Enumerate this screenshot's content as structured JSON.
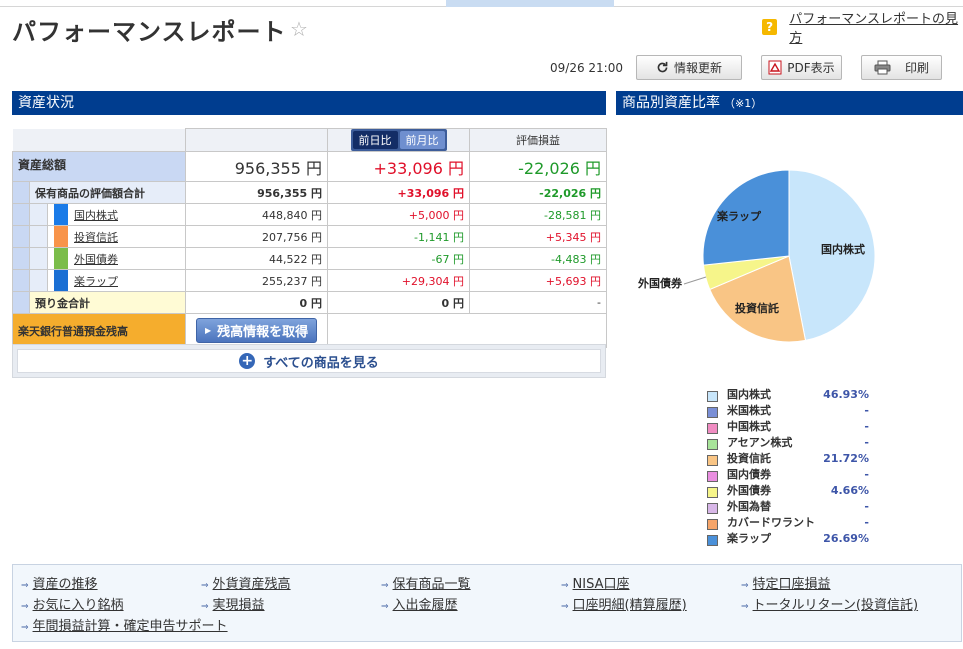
{
  "page": {
    "title": "パフォーマンスレポート",
    "help_link": "パフォーマンスレポートの見方",
    "timestamp": "09/26 21:00"
  },
  "toolbar": {
    "refresh_label": "情報更新",
    "pdf_label": "PDF表示",
    "print_label": "印刷"
  },
  "asset_section": {
    "title": "資産状況",
    "tabs": [
      "前日比",
      "前月比"
    ],
    "col_eval": "評価損益",
    "total": {
      "label": "資産総額",
      "amount": "956,355 円",
      "change": "+33,096 円",
      "eval": "-22,026 円"
    },
    "holdings": {
      "label": "保有商品の評価額合計",
      "amount": "956,355 円",
      "change": "+33,096 円",
      "eval": "-22,026 円"
    },
    "categories": [
      {
        "name": "国内株式",
        "amount": "448,840 円",
        "change": "+5,000 円",
        "eval": "-28,581 円",
        "color": "#1a7be8",
        "change_sign": "pos",
        "eval_sign": "neg"
      },
      {
        "name": "投資信託",
        "amount": "207,756 円",
        "change": "-1,141 円",
        "eval": "+5,345 円",
        "color": "#f8944a",
        "change_sign": "neg",
        "eval_sign": "pos"
      },
      {
        "name": "外国債券",
        "amount": "44,522 円",
        "change": "-67 円",
        "eval": "-4,483 円",
        "color": "#7bbd4a",
        "change_sign": "neg",
        "eval_sign": "neg"
      },
      {
        "name": "楽ラップ",
        "amount": "255,237 円",
        "change": "+29,304 円",
        "eval": "+5,693 円",
        "color": "#1a6fd4",
        "change_sign": "pos",
        "eval_sign": "pos"
      }
    ],
    "deposit": {
      "label": "預り金合計",
      "amount": "0 円",
      "change": "0 円",
      "eval": "-"
    },
    "bank": {
      "label": "楽天銀行普通預金残高",
      "button": "残高情報を取得"
    },
    "see_all": "すべての商品を見る"
  },
  "ratio_section": {
    "title": "商品別資産比率",
    "note": "（※1）",
    "pie_labels": [
      "国内株式",
      "投資信託",
      "外国債券",
      "楽ラップ"
    ],
    "legend": [
      {
        "name": "国内株式",
        "pct": "46.93%",
        "color": "#c8e6fb"
      },
      {
        "name": "米国株式",
        "pct": "-",
        "color": "#7a8fd6"
      },
      {
        "name": "中国株式",
        "pct": "-",
        "color": "#f08cc2"
      },
      {
        "name": "アセアン株式",
        "pct": "-",
        "color": "#a8e49a"
      },
      {
        "name": "投資信託",
        "pct": "21.72%",
        "color": "#f9c585"
      },
      {
        "name": "国内債券",
        "pct": "-",
        "color": "#e98ee0"
      },
      {
        "name": "外国債券",
        "pct": "4.66%",
        "color": "#f6f58a"
      },
      {
        "name": "外国為替",
        "pct": "-",
        "color": "#d8b7e8"
      },
      {
        "name": "カバードワラント",
        "pct": "-",
        "color": "#f6a56a"
      },
      {
        "name": "楽ラップ",
        "pct": "26.69%",
        "color": "#4a90d9"
      }
    ]
  },
  "chart_data": {
    "type": "pie",
    "categories": [
      "国内株式",
      "投資信託",
      "外国債券",
      "楽ラップ"
    ],
    "values": [
      46.93,
      21.72,
      4.66,
      26.69
    ],
    "colors": [
      "#c8e6fb",
      "#f9c585",
      "#f6f58a",
      "#4a90d9"
    ]
  },
  "footer_links": [
    [
      "資産の推移",
      "外貨資産残高",
      "保有商品一覧",
      "NISA口座",
      "特定口座損益"
    ],
    [
      "お気に入り銘柄",
      "実現損益",
      "入出金履歴",
      "口座明細(精算履歴)",
      "トータルリターン(投資信託)"
    ],
    [
      "年間損益計算・確定申告サポート"
    ]
  ]
}
